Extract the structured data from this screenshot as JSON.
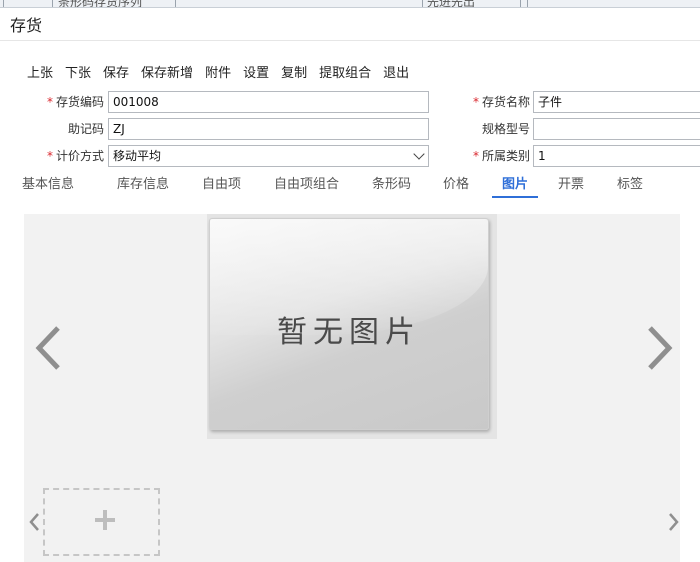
{
  "background_strip": {
    "col1": "条形码存货序列",
    "col2": "先进先出"
  },
  "window": {
    "title": "存货"
  },
  "toolbar": {
    "items": [
      "上张",
      "下张",
      "保存",
      "保存新增",
      "附件",
      "设置",
      "复制",
      "提取组合",
      "退出"
    ]
  },
  "form": {
    "code": {
      "label": "存货编码",
      "required": true,
      "value": "001008"
    },
    "name": {
      "label": "存货名称",
      "required": true,
      "value": "子件"
    },
    "mnemonic": {
      "label": "助记码",
      "required": false,
      "value": "ZJ"
    },
    "spec": {
      "label": "规格型号",
      "required": false,
      "value": ""
    },
    "pricing": {
      "label": "计价方式",
      "required": true,
      "value": "移动平均"
    },
    "category": {
      "label": "所属类别",
      "required": true,
      "value": "1"
    }
  },
  "tabs": {
    "items": [
      "基本信息",
      "库存信息",
      "自由项",
      "自由项组合",
      "条形码",
      "价格",
      "图片",
      "开票",
      "标签"
    ],
    "active": "图片"
  },
  "image_panel": {
    "placeholder_text": "暂无图片"
  },
  "colors": {
    "accent": "#2f6fd8",
    "required": "#d9272e",
    "panel": "#f2f2f2"
  }
}
